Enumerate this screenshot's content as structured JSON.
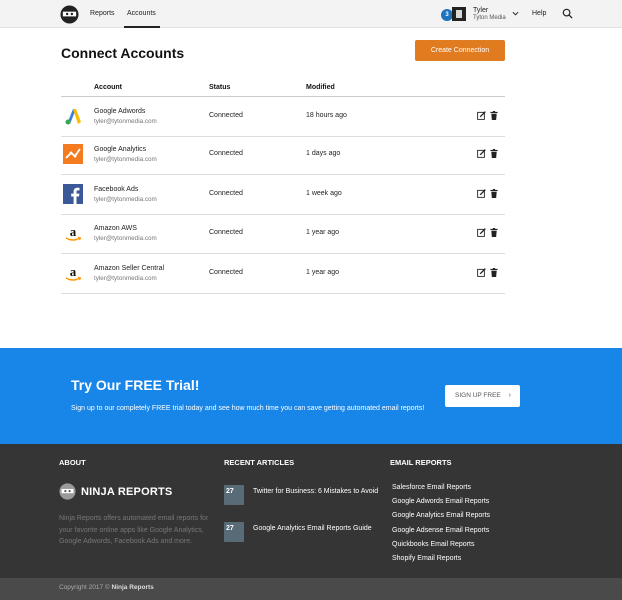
{
  "nav": {
    "links": [
      "Reports",
      "Accounts"
    ],
    "active": "Accounts",
    "user": {
      "badge": "3",
      "name": "Tyler",
      "org": "Tyton Media"
    },
    "help": "Help"
  },
  "main": {
    "title": "Connect Accounts",
    "create_label": "Create Connection",
    "columns": [
      "Account",
      "Status",
      "Modified"
    ],
    "rows": [
      {
        "icon": "google-adwords-icon",
        "name": "Google Adwords",
        "email": "tyler@tytonmedia.com",
        "status": "Connected",
        "modified": "18 hours ago"
      },
      {
        "icon": "google-analytics-icon",
        "name": "Google Analytics",
        "email": "tyler@tytonmedia.com",
        "status": "Connected",
        "modified": "1 days ago"
      },
      {
        "icon": "facebook-icon",
        "name": "Facebook Ads",
        "email": "tyler@tytonmedia.com",
        "status": "Connected",
        "modified": "1 week ago"
      },
      {
        "icon": "amazon-icon",
        "name": "Amazon AWS",
        "email": "tyler@tytonmedia.com",
        "status": "Connected",
        "modified": "1 year ago"
      },
      {
        "icon": "amazon-icon",
        "name": "Amazon Seller Central",
        "email": "tyler@tytonmedia.com",
        "status": "Connected",
        "modified": "1 year ago"
      }
    ]
  },
  "banner": {
    "title": "Try Our FREE Trial!",
    "text": "Sign up to our completely FREE trial today and see how much time you can save getting automated email reports!",
    "button": "SIGN UP FREE"
  },
  "footer": {
    "about_heading": "ABOUT",
    "brand": "NINJA REPORTS",
    "about_text": "Ninja Reports offers automated email reports for your favorite online apps like Google Analytics, Google Adwords, Facebook Ads and more.",
    "recent_heading": "RECENT ARTICLES",
    "articles": [
      {
        "thumb": "27",
        "title": "Twitter for Business: 6 Mistakes to Avoid"
      },
      {
        "thumb": "27",
        "title": "Google Analytics Email Reports Guide"
      }
    ],
    "email_heading": "EMAIL REPORTS",
    "email_links": [
      "Salesforce Email Reports",
      "Google Adwords Email Reports",
      "Google Analytics Email Reports",
      "Google Adsense Email Reports",
      "Quickbooks Email Reports",
      "Shopify Email Reports"
    ],
    "copyright_prefix": "Copyright 2017 ©",
    "copyright_brand": "Ninja Reports"
  },
  "colors": {
    "accent": "#e07b20",
    "banner": "#1886e8",
    "footer": "#353535"
  }
}
